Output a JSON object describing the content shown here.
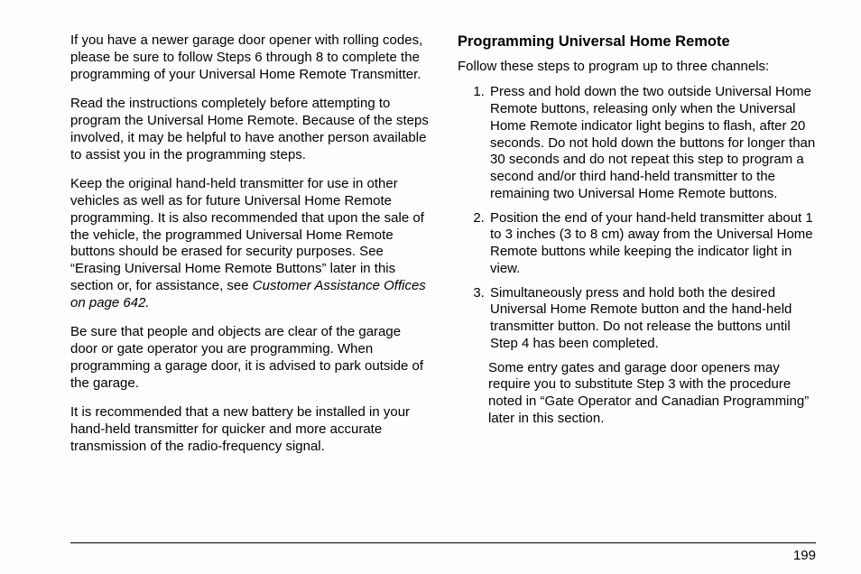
{
  "left": {
    "p1": "If you have a newer garage door opener with rolling codes, please be sure to follow Steps 6 through 8 to complete the programming of your Universal Home Remote Transmitter.",
    "p2": "Read the instructions completely before attempting to program the Universal Home Remote. Because of the steps involved, it may be helpful to have another person available to assist you in the programming steps.",
    "p3a": "Keep the original hand-held transmitter for use in other vehicles as well as for future Universal Home Remote programming. It is also recommended that upon the sale of the vehicle, the programmed Universal Home Remote buttons should be erased for security purposes. See “Erasing Universal Home Remote Buttons” later in this section or, for assistance, see ",
    "p3_italic": "Customer Assistance Offices on page 642.",
    "p4": "Be sure that people and objects are clear of the garage door or gate operator you are programming. When programming a garage door, it is advised to park outside of the garage.",
    "p5": "It is recommended that a new battery be installed in your hand-held transmitter for quicker and more accurate transmission of the radio-frequency signal."
  },
  "right": {
    "heading": "Programming Universal Home Remote",
    "intro": "Follow these steps to program up to three channels:",
    "steps": {
      "s1": "Press and hold down the two outside Universal Home Remote buttons, releasing only when the Universal Home Remote indicator light begins to flash, after 20 seconds. Do not hold down the buttons for longer than 30 seconds and do not repeat this step to program a second and/or third hand-held transmitter to the remaining two Universal Home Remote buttons.",
      "s2": "Position the end of your hand-held transmitter about 1 to 3 inches (3 to 8 cm) away from the Universal Home Remote buttons while keeping the indicator light in view.",
      "s3": "Simultaneously press and hold both the desired Universal Home Remote button and the hand-held transmitter button. Do not release the buttons until Step 4 has been completed."
    },
    "sub": "Some entry gates and garage door openers may require you to substitute Step 3 with the procedure noted in “Gate Operator and Canadian Programming” later in this section."
  },
  "page_number": "199"
}
